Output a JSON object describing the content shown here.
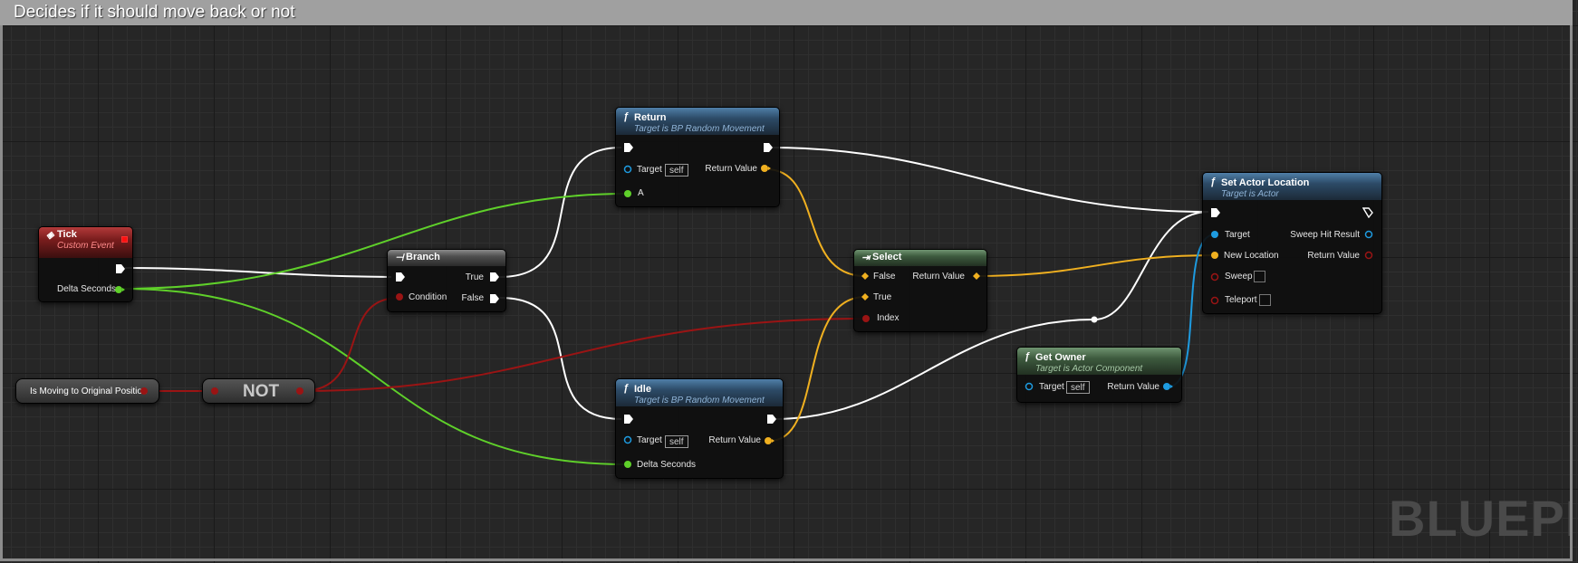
{
  "comment": {
    "title": "Decides if it should move back or not"
  },
  "watermark": "BLUEPR",
  "colors": {
    "exec_wire": "#ffffff",
    "float_wire": "#5fd02a",
    "bool_wire": "#9a1414",
    "vector_wire": "#f0b020",
    "object_wire": "#1e9be0"
  },
  "nodes": {
    "tick": {
      "icon": "event-icon",
      "title": "Tick",
      "subtitle": "Custom Event",
      "pin_delta": "Delta Seconds"
    },
    "branch": {
      "icon": "branch-icon",
      "title": "Branch",
      "pin_condition": "Condition",
      "pin_true": "True",
      "pin_false": "False"
    },
    "return": {
      "icon": "function-icon",
      "title": "Return",
      "subtitle": "Target is BP Random Movement",
      "pin_target": "Target",
      "self": "self",
      "pin_return": "Return Value",
      "pin_a": "A"
    },
    "idle": {
      "icon": "function-icon",
      "title": "Idle",
      "subtitle": "Target is BP Random Movement",
      "pin_target": "Target",
      "self": "self",
      "pin_return": "Return Value",
      "pin_delta": "Delta Seconds"
    },
    "select": {
      "icon": "select-icon",
      "title": "Select",
      "pin_false": "False",
      "pin_true": "True",
      "pin_index": "Index",
      "pin_return": "Return Value"
    },
    "get_owner": {
      "icon": "function-icon",
      "title": "Get Owner",
      "subtitle": "Target is Actor Component",
      "pin_target": "Target",
      "self": "self",
      "pin_return": "Return Value"
    },
    "set_actor_location": {
      "icon": "function-icon",
      "title": "Set Actor Location",
      "subtitle": "Target is Actor",
      "pin_target": "Target",
      "pin_new_location": "New Location",
      "pin_sweep": "Sweep",
      "pin_teleport": "Teleport",
      "pin_sweep_hit": "Sweep Hit Result",
      "pin_return": "Return Value"
    },
    "is_moving": {
      "label": "Is Moving to Original Position"
    },
    "not": {
      "label": "NOT"
    }
  }
}
